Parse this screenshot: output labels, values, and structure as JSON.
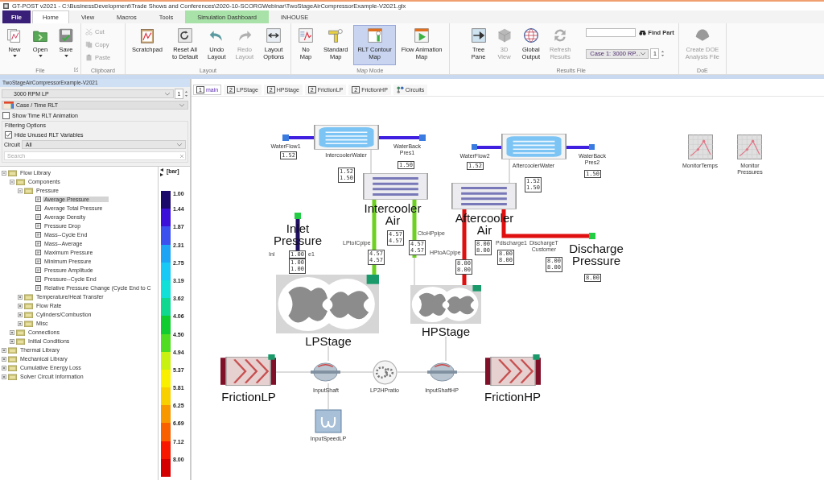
{
  "window": {
    "title": "GT-POST v2021 - C:\\BusinessDevelopment\\Trade Shows and Conferences\\2020-10-SCORGWebinar\\TwoStageAirCompressorExample-V2021.glx"
  },
  "menu_tabs": [
    {
      "label": "File",
      "kind": "file",
      "selected": false
    },
    {
      "label": "Home",
      "kind": "tab",
      "selected": true
    },
    {
      "label": "View",
      "kind": "tab",
      "selected": false
    },
    {
      "label": "Macros",
      "kind": "tab",
      "selected": false
    },
    {
      "label": "Tools",
      "kind": "tab",
      "selected": false
    },
    {
      "label": "Simulation Dashboard",
      "kind": "context",
      "selected": false
    },
    {
      "label": "INHOUSE",
      "kind": "tab",
      "selected": false
    }
  ],
  "ribbon": {
    "groups": [
      {
        "label": "File",
        "launcher": true,
        "buttons": [
          {
            "label": "New",
            "kind": "large",
            "dropdown": true,
            "disabled": false
          },
          {
            "label": "Open",
            "kind": "large",
            "dropdown": true,
            "disabled": false
          },
          {
            "label": "Save",
            "kind": "large",
            "dropdown": true,
            "disabled": false
          }
        ]
      },
      {
        "label": "Clipboard",
        "buttons": [
          {
            "label": "Cut",
            "kind": "small",
            "disabled": true
          },
          {
            "label": "Copy",
            "kind": "small",
            "disabled": true
          },
          {
            "label": "Paste",
            "kind": "small",
            "disabled": true
          }
        ]
      },
      {
        "label": "Layout",
        "buttons": [
          {
            "label": "Scratchpad",
            "kind": "large",
            "disabled": false
          },
          {
            "label": "Reset All\nto Default",
            "kind": "large",
            "disabled": false
          },
          {
            "label": "Undo\nLayout",
            "kind": "large",
            "disabled": false
          },
          {
            "label": "Redo\nLayout",
            "kind": "large",
            "disabled": true
          },
          {
            "label": "Layout\nOptions",
            "kind": "large",
            "disabled": false
          }
        ]
      },
      {
        "label": "Map Mode",
        "buttons": [
          {
            "label": "No\nMap",
            "kind": "large",
            "disabled": false,
            "selected": false
          },
          {
            "label": "Standard\nMap",
            "kind": "large",
            "disabled": false,
            "selected": false
          },
          {
            "label": "RLT Contour\nMap",
            "kind": "large",
            "disabled": false,
            "selected": true
          },
          {
            "label": "Flow Animation\nMap",
            "kind": "large",
            "disabled": false,
            "selected": false
          }
        ]
      },
      {
        "label": "Results File",
        "buttons": [
          {
            "label": "Tree\nPane",
            "kind": "large",
            "disabled": false
          },
          {
            "label": "3D\nView",
            "kind": "large",
            "disabled": true
          },
          {
            "label": "Global\nOutput",
            "kind": "large",
            "disabled": false
          },
          {
            "label": "Refresh\nResults",
            "kind": "large",
            "disabled": true
          }
        ],
        "find": {
          "label": "Find Part"
        },
        "case_select": {
          "value": "Case 1: 3000 RP...",
          "spin": "1"
        }
      },
      {
        "label": "DoE",
        "buttons": [
          {
            "label": "Create DOE\nAnalysis File",
            "kind": "large",
            "disabled": true
          }
        ]
      }
    ]
  },
  "left_panel": {
    "title": "TwoStageAirCompressorExample-V2021",
    "case_select": {
      "value": "3000 RPM LP",
      "spin": "1"
    },
    "rlt_select": {
      "value": "Case / Time RLT"
    },
    "show_animation": {
      "label": "Show Time RLT Animation",
      "checked": false
    },
    "filtering": {
      "title": "Filtering Options",
      "hide_unused": {
        "label": "Hide Unused RLT Variables",
        "checked": true
      },
      "circuit": {
        "label": "Circuit",
        "value": "All"
      },
      "search": {
        "placeholder": "Search"
      }
    },
    "tree": [
      {
        "label": "Flow Library",
        "kind": "folder",
        "expanded": true,
        "selected": false,
        "children": [
          {
            "label": "Components",
            "kind": "folder",
            "expanded": true,
            "selected": false,
            "children": [
              {
                "label": "Pressure",
                "kind": "folder",
                "expanded": true,
                "selected": false,
                "children": [
                  {
                    "label": "Average Pressure",
                    "kind": "variable",
                    "selected": true
                  },
                  {
                    "label": "Average Total Pressure",
                    "kind": "variable",
                    "selected": false
                  },
                  {
                    "label": "Average Density",
                    "kind": "variable",
                    "selected": false
                  },
                  {
                    "label": "Pressure Drop",
                    "kind": "variable",
                    "selected": false
                  },
                  {
                    "label": "Mass--Cycle End",
                    "kind": "variable",
                    "selected": false
                  },
                  {
                    "label": "Mass--Average",
                    "kind": "variable",
                    "selected": false
                  },
                  {
                    "label": "Maximum Pressure",
                    "kind": "variable",
                    "selected": false
                  },
                  {
                    "label": "Minimum Pressure",
                    "kind": "variable",
                    "selected": false
                  },
                  {
                    "label": "Pressure Amplitude",
                    "kind": "variable",
                    "selected": false
                  },
                  {
                    "label": "Pressure--Cycle End",
                    "kind": "variable",
                    "selected": false
                  },
                  {
                    "label": "Relative Pressure Change (Cycle End to C",
                    "kind": "variable",
                    "selected": false
                  }
                ]
              },
              {
                "label": "Temperature/Heat Transfer",
                "kind": "folder",
                "expanded": false,
                "selected": false
              },
              {
                "label": "Flow Rate",
                "kind": "folder",
                "expanded": false,
                "selected": false
              },
              {
                "label": "Cylinders/Combustion",
                "kind": "folder",
                "expanded": false,
                "selected": false
              },
              {
                "label": "Misc",
                "kind": "folder",
                "expanded": false,
                "selected": false
              }
            ]
          },
          {
            "label": "Connections",
            "kind": "folder",
            "expanded": false,
            "selected": false
          },
          {
            "label": "Initial Conditions",
            "kind": "folder",
            "expanded": false,
            "selected": false
          }
        ]
      },
      {
        "label": "Thermal Library",
        "kind": "folder",
        "expanded": false,
        "selected": false
      },
      {
        "label": "Mechanical Library",
        "kind": "folder",
        "expanded": false,
        "selected": false
      },
      {
        "label": "Cumulative Energy Loss",
        "kind": "folder",
        "expanded": false,
        "selected": false
      },
      {
        "label": "Solver Circuit Information",
        "kind": "folder",
        "expanded": false,
        "selected": false
      }
    ],
    "legend": {
      "unit": "[bar]",
      "bands": [
        {
          "label": "1.00",
          "color": "#1c0a6a"
        },
        {
          "label": "1.44",
          "color": "#3c10d8"
        },
        {
          "label": "1.87",
          "color": "#3c50f0"
        },
        {
          "label": "2.31",
          "color": "#1ea4f5"
        },
        {
          "label": "2.75",
          "color": "#18c8f5"
        },
        {
          "label": "3.19",
          "color": "#10e0d8"
        },
        {
          "label": "3.62",
          "color": "#10d890"
        },
        {
          "label": "4.06",
          "color": "#10cc30"
        },
        {
          "label": "4.50",
          "color": "#50dc20"
        },
        {
          "label": "4.94",
          "color": "#c8f010"
        },
        {
          "label": "5.37",
          "color": "#f8f000"
        },
        {
          "label": "5.81",
          "color": "#f8d000"
        },
        {
          "label": "6.25",
          "color": "#f89800"
        },
        {
          "label": "6.69",
          "color": "#f86000"
        },
        {
          "label": "7.12",
          "color": "#f81800"
        },
        {
          "label": "8.00",
          "color": "#d40000"
        }
      ]
    }
  },
  "canvas_tabs": [
    {
      "label": "main",
      "number": "1",
      "kind": "page",
      "selected": true
    },
    {
      "label": "LPStage",
      "number": "2",
      "kind": "page",
      "selected": false
    },
    {
      "label": "HPStage",
      "number": "2",
      "kind": "page",
      "selected": false
    },
    {
      "label": "FrictionLP",
      "number": "2",
      "kind": "page",
      "selected": false
    },
    {
      "label": "FrictionHP",
      "number": "2",
      "kind": "page",
      "selected": false
    },
    {
      "label": "Circuits",
      "kind": "circuits",
      "selected": false
    }
  ],
  "diagram": {
    "components": [
      {
        "name": "WaterFlow1",
        "kind": "boundary",
        "color": "#3a7be0",
        "large_label": false
      },
      {
        "name": "IntercoolerWater",
        "kind": "cooler-water",
        "large_label": false
      },
      {
        "name": "WaterBack\nPres1",
        "kind": "boundary",
        "color": "#3a7be0",
        "large_label": false
      },
      {
        "name": "Intercooler\nAir",
        "kind": "cooler-air",
        "large_label": true
      },
      {
        "name": "Inlet\nPressure",
        "kind": "boundary",
        "color": "#22cc44",
        "large_label": true
      },
      {
        "name": "LPStage",
        "kind": "compressor",
        "large_label": true
      },
      {
        "name": "HPStage",
        "kind": "compressor",
        "large_label": true
      },
      {
        "name": "WaterFlow2",
        "kind": "boundary",
        "color": "#3a7be0",
        "large_label": false
      },
      {
        "name": "AftercoolerWater",
        "kind": "cooler-water",
        "large_label": false
      },
      {
        "name": "WaterBack\nPres2",
        "kind": "boundary",
        "color": "#3a7be0",
        "large_label": false
      },
      {
        "name": "Aftercooler\nAir",
        "kind": "cooler-air",
        "large_label": true
      },
      {
        "name": "Discharge\nPressure",
        "kind": "boundary",
        "color": "#22cc44",
        "large_label": true
      },
      {
        "name": "MonitorTemps",
        "kind": "monitor",
        "large_label": false
      },
      {
        "name": "Monitor\nPressures",
        "kind": "monitor",
        "large_label": false
      },
      {
        "name": "FrictionLP",
        "kind": "friction",
        "large_label": true
      },
      {
        "name": "InputShaft",
        "kind": "shaft",
        "large_label": false
      },
      {
        "name": "LP2HPratio",
        "kind": "gear",
        "large_label": false
      },
      {
        "name": "InputShaftHP",
        "kind": "shaft",
        "large_label": false
      },
      {
        "name": "FrictionHP",
        "kind": "friction",
        "large_label": true
      },
      {
        "name": "InputSpeedLP",
        "kind": "speed",
        "large_label": false
      }
    ],
    "pipe_labels": [
      "LPtoICpipe",
      "CtoHPpipe",
      "Inl",
      "e1",
      "HPtoACpipe",
      "Pdischarge1",
      "DischargeT\nCustomer"
    ],
    "readouts": [
      {
        "values": [
          "1.52"
        ]
      },
      {
        "values": [
          "1.50"
        ]
      },
      {
        "values": [
          "1.52",
          "1.50"
        ]
      },
      {
        "values": [
          "4.57",
          "4.57"
        ]
      },
      {
        "values": [
          "4.57",
          "4.57"
        ]
      },
      {
        "values": [
          "4.57",
          "4.57"
        ]
      },
      {
        "values": [
          "1.00"
        ]
      },
      {
        "values": [
          "1.00",
          "1.00"
        ]
      },
      {
        "values": [
          "1.52"
        ]
      },
      {
        "values": [
          "1.50"
        ]
      },
      {
        "values": [
          "1.52",
          "1.50"
        ]
      },
      {
        "values": [
          "8.00",
          "8.00"
        ]
      },
      {
        "values": [
          "8.00",
          "8.00"
        ]
      },
      {
        "values": [
          "8.00",
          "8.00"
        ]
      },
      {
        "values": [
          "8.00",
          "8.00"
        ]
      },
      {
        "values": [
          "8.00"
        ]
      }
    ]
  }
}
